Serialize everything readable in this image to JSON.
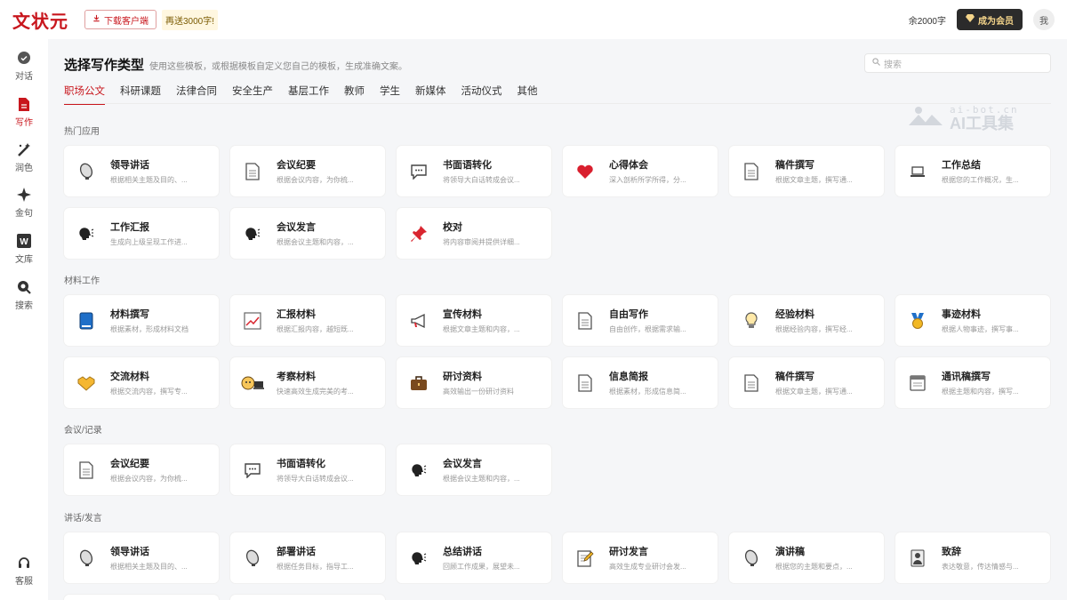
{
  "header": {
    "logo": "文状元",
    "download_label": "下载客户端",
    "promo": "再送3000字!",
    "quota": "余2000字",
    "vip_label": "成为会员",
    "avatar_text": "我"
  },
  "sidebar": {
    "items": [
      {
        "label": "对话",
        "icon": "chat-icon"
      },
      {
        "label": "写作",
        "icon": "write-icon",
        "active": true
      },
      {
        "label": "润色",
        "icon": "polish-icon"
      },
      {
        "label": "金句",
        "icon": "sparkle-icon"
      },
      {
        "label": "文库",
        "icon": "library-icon"
      },
      {
        "label": "搜索",
        "icon": "search-icon"
      }
    ],
    "bottom": {
      "label": "客服",
      "icon": "headset-icon"
    }
  },
  "main": {
    "title": "选择写作类型",
    "desc": "使用这些模板，或根据模板自定义您自己的模板，生成准确文案。",
    "search_placeholder": "搜索",
    "tabs": [
      "职场公文",
      "科研课题",
      "法律合同",
      "安全生产",
      "基层工作",
      "教师",
      "学生",
      "新媒体",
      "活动仪式",
      "其他"
    ],
    "watermark": {
      "line1": "ai-bot.cn",
      "line2": "AI工具集"
    },
    "sections": [
      {
        "title": "热门应用",
        "cards": [
          {
            "title": "领导讲话",
            "desc": "根据相关主题及目的、...",
            "icon": "bulb-shape-icon"
          },
          {
            "title": "会议纪要",
            "desc": "根据会议内容，为你梳...",
            "icon": "document-icon"
          },
          {
            "title": "书面语转化",
            "desc": "将领导大白话转成会议...",
            "icon": "speech-bubble-icon"
          },
          {
            "title": "心得体会",
            "desc": "深入剖析所学所得，分...",
            "icon": "heart-icon"
          },
          {
            "title": "稿件撰写",
            "desc": "根据文章主题，撰写通...",
            "icon": "document-icon"
          },
          {
            "title": "工作总结",
            "desc": "根据您的工作概况，生...",
            "icon": "laptop-icon"
          },
          {
            "title": "工作汇报",
            "desc": "生成向上级呈现工作进...",
            "icon": "speaking-head-icon"
          },
          {
            "title": "会议发言",
            "desc": "根据会议主题和内容，...",
            "icon": "speaking-head-icon"
          },
          {
            "title": "校对",
            "desc": "将内容审阅并提供详细...",
            "icon": "pin-icon"
          }
        ]
      },
      {
        "title": "材料工作",
        "cards": [
          {
            "title": "材料撰写",
            "desc": "根据素材，形成材料文档",
            "icon": "book-icon"
          },
          {
            "title": "汇报材料",
            "desc": "根据汇报内容，越短既...",
            "icon": "chart-up-icon"
          },
          {
            "title": "宣传材料",
            "desc": "根据文章主题和内容，...",
            "icon": "megaphone-icon"
          },
          {
            "title": "自由写作",
            "desc": "自由创作，根据需求输...",
            "icon": "document-icon"
          },
          {
            "title": "经验材料",
            "desc": "根据经验内容，撰写经...",
            "icon": "lightbulb-icon"
          },
          {
            "title": "事迹材料",
            "desc": "根据人物事迹，撰写事...",
            "icon": "medal-icon"
          },
          {
            "title": "交流材料",
            "desc": "根据交流内容，撰写专...",
            "icon": "handshake-icon"
          },
          {
            "title": "考察材料",
            "desc": "快速高效生成完美的考...",
            "icon": "inspector-icon"
          },
          {
            "title": "研讨资料",
            "desc": "高效输出一份研讨资料",
            "icon": "briefcase-icon"
          },
          {
            "title": "信息简报",
            "desc": "根据素材，形成信息简...",
            "icon": "document-icon"
          },
          {
            "title": "稿件撰写",
            "desc": "根据文章主题，撰写通...",
            "icon": "document-icon"
          },
          {
            "title": "通讯稿撰写",
            "desc": "根据主题和内容，撰写...",
            "icon": "window-icon"
          }
        ]
      },
      {
        "title": "会议/记录",
        "cards": [
          {
            "title": "会议纪要",
            "desc": "根据会议内容，为你梳...",
            "icon": "document-icon"
          },
          {
            "title": "书面语转化",
            "desc": "将领导大白话转成会议...",
            "icon": "speech-bubble-icon"
          },
          {
            "title": "会议发言",
            "desc": "根据会议主题和内容，...",
            "icon": "speaking-head-icon"
          }
        ]
      },
      {
        "title": "讲话/发言",
        "cards": [
          {
            "title": "领导讲话",
            "desc": "根据相关主题及目的、...",
            "icon": "bulb-shape-icon"
          },
          {
            "title": "部署讲话",
            "desc": "根据任务目标，指导工...",
            "icon": "bulb-shape-icon"
          },
          {
            "title": "总结讲话",
            "desc": "回顾工作成果，展望未...",
            "icon": "speaking-head-icon"
          },
          {
            "title": "研讨发言",
            "desc": "高效生成专业研讨会发...",
            "icon": "memo-icon"
          },
          {
            "title": "演讲稿",
            "desc": "根据您的主题和要点，...",
            "icon": "bulb-shape-icon"
          },
          {
            "title": "致辞",
            "desc": "表达敬意，传达情感与...",
            "icon": "person-icon"
          }
        ]
      }
    ]
  },
  "colors": {
    "accent": "#c8161d",
    "background": "#f5f6f8",
    "card": "#ffffff"
  }
}
